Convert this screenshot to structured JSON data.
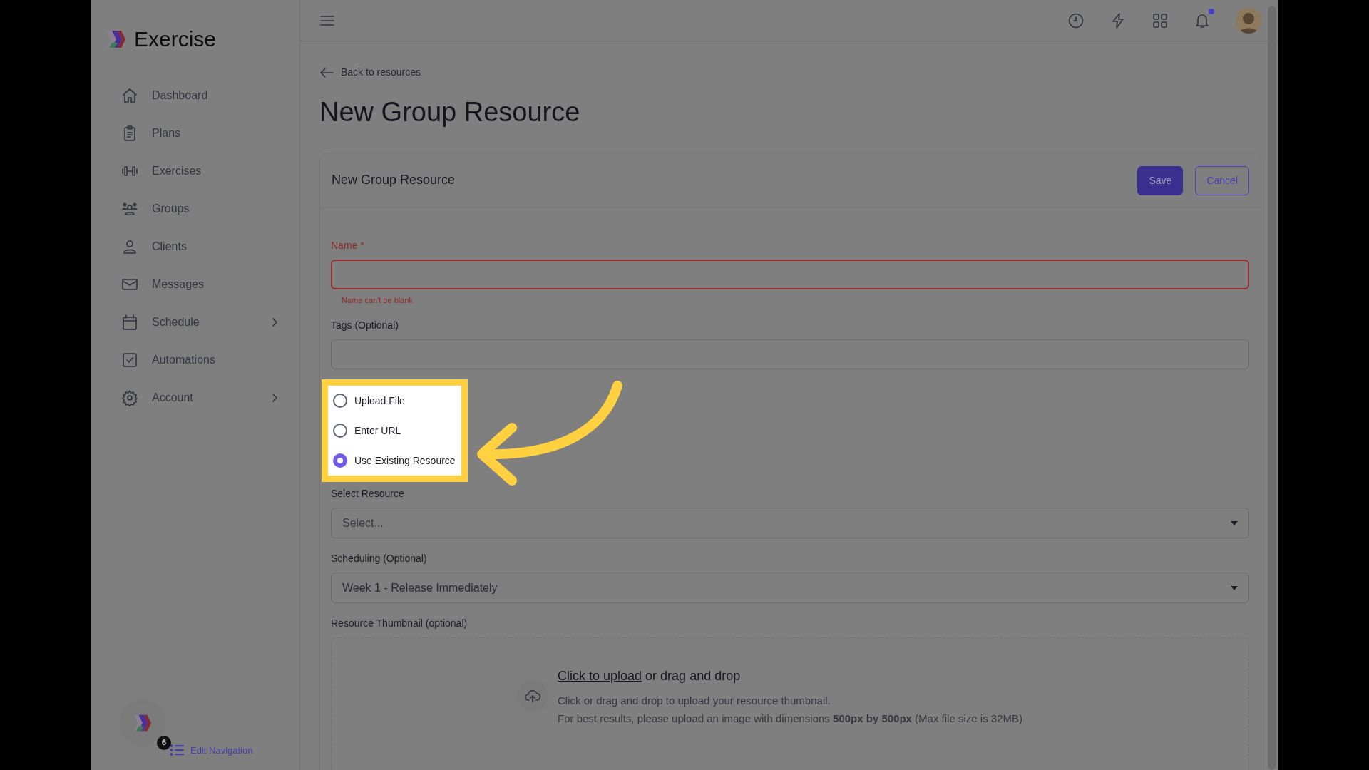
{
  "sidebar": {
    "logo_text": "Exercise",
    "items": [
      {
        "label": "Dashboard",
        "expandable": false
      },
      {
        "label": "Plans",
        "expandable": false
      },
      {
        "label": "Exercises",
        "expandable": false
      },
      {
        "label": "Groups",
        "expandable": false
      },
      {
        "label": "Clients",
        "expandable": false
      },
      {
        "label": "Messages",
        "expandable": false
      },
      {
        "label": "Schedule",
        "expandable": true
      },
      {
        "label": "Automations",
        "expandable": false
      },
      {
        "label": "Account",
        "expandable": true
      }
    ],
    "launcher_badge": "6",
    "edit_navigation": "Edit Navigation"
  },
  "topbar": {
    "notification_unread": true
  },
  "back_link": "Back to resources",
  "page_title": "New Group Resource",
  "card": {
    "title": "New Group Resource",
    "buttons": [
      {
        "label": "Save",
        "kind": "primary"
      },
      {
        "label": "Cancel",
        "kind": "outline"
      }
    ],
    "fields": [
      {
        "kind": "text",
        "label": "Name *",
        "invalid": true,
        "error": "Name can't be blank"
      },
      {
        "kind": "text",
        "label": "Tags (Optional)",
        "invalid": false
      },
      {
        "kind": "radio",
        "highlighted": true,
        "options": [
          {
            "label": "Upload File",
            "selected": false
          },
          {
            "label": "Enter URL",
            "selected": false
          },
          {
            "label": "Use Existing Resource",
            "selected": true
          }
        ]
      },
      {
        "kind": "select",
        "label": "Select Resource",
        "placeholder": "Select..."
      },
      {
        "kind": "select",
        "label": "Scheduling (Optional)",
        "value": "Week 1 - Release Immediately"
      },
      {
        "kind": "dropzone",
        "label": "Resource Thumbnail (optional)",
        "link": "Click to upload",
        "title_rest": "or drag and drop",
        "lines": [
          "Click or drag and drop to upload your resource thumbnail.",
          "For best results, please upload an image with dimensions **500px by 500px** (Max file size is 32MB)"
        ]
      }
    ]
  }
}
